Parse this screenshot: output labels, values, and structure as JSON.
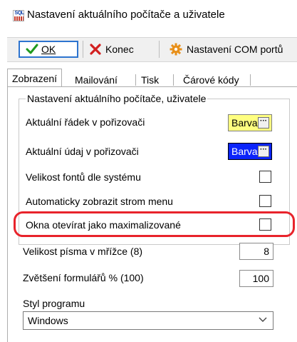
{
  "window": {
    "title": "Nastavení aktuálního počítače a uživatele",
    "icon": "sql-app-icon",
    "icon_text": "SQL"
  },
  "toolbar": {
    "ok_label": "OK",
    "konec_label": "Konec",
    "com_label": "Nastavení COM portů"
  },
  "tabs": [
    {
      "label": "Zobrazení",
      "active": true
    },
    {
      "label": "Mailování",
      "active": false
    },
    {
      "label": "Tisk",
      "active": false
    },
    {
      "label": "Čárové kódy",
      "active": false
    }
  ],
  "group": {
    "legend": "Nastavení aktuálního počítače, uživatele",
    "rows": [
      {
        "label": "Aktuální řádek v pořizovači",
        "control": "color",
        "value": "Barva",
        "bg": "#ffff80",
        "fg": "#000000"
      },
      {
        "label": "Aktuální údaj v pořizovači",
        "control": "color",
        "value": "Barva",
        "bg": "#0b24fb",
        "fg": "#ffffff"
      },
      {
        "label": "Velikost fontů dle systému",
        "control": "checkbox",
        "checked": false
      },
      {
        "label": "Automaticky zobrazit strom menu",
        "control": "checkbox",
        "checked": false
      },
      {
        "label": "Okna otevírat jako maximalizované",
        "control": "checkbox",
        "checked": false,
        "highlighted": true
      }
    ]
  },
  "settings": {
    "font_size_label": "Velikost písma v mřížce (8)",
    "font_size_value": "8",
    "zoom_label": "Zvětšení formulářů % (100)",
    "zoom_value": "100",
    "style_label": "Styl programu",
    "style_value": "Windows"
  },
  "colors": {
    "highlight": "#e8232b",
    "ok_border": "#2d74cf"
  }
}
